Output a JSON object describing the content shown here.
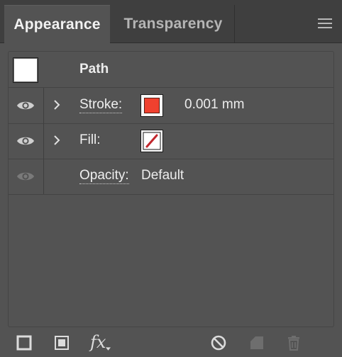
{
  "tabs": {
    "active": "Appearance",
    "inactive": "Transparency"
  },
  "object": {
    "type_label": "Path"
  },
  "attributes": {
    "stroke": {
      "label": "Stroke:",
      "color": "#f0412f",
      "weight": "0.001 mm"
    },
    "fill": {
      "label": "Fill:",
      "color": "none"
    },
    "opacity": {
      "label": "Opacity:",
      "value": "Default"
    }
  },
  "toolbar": {
    "fx_label": "fx"
  },
  "colors": {
    "panel_bg": "#535353",
    "tab_bar_bg": "#3f3f3f",
    "stroke_swatch": "#f0412f",
    "none_slash": "#c1272d"
  }
}
